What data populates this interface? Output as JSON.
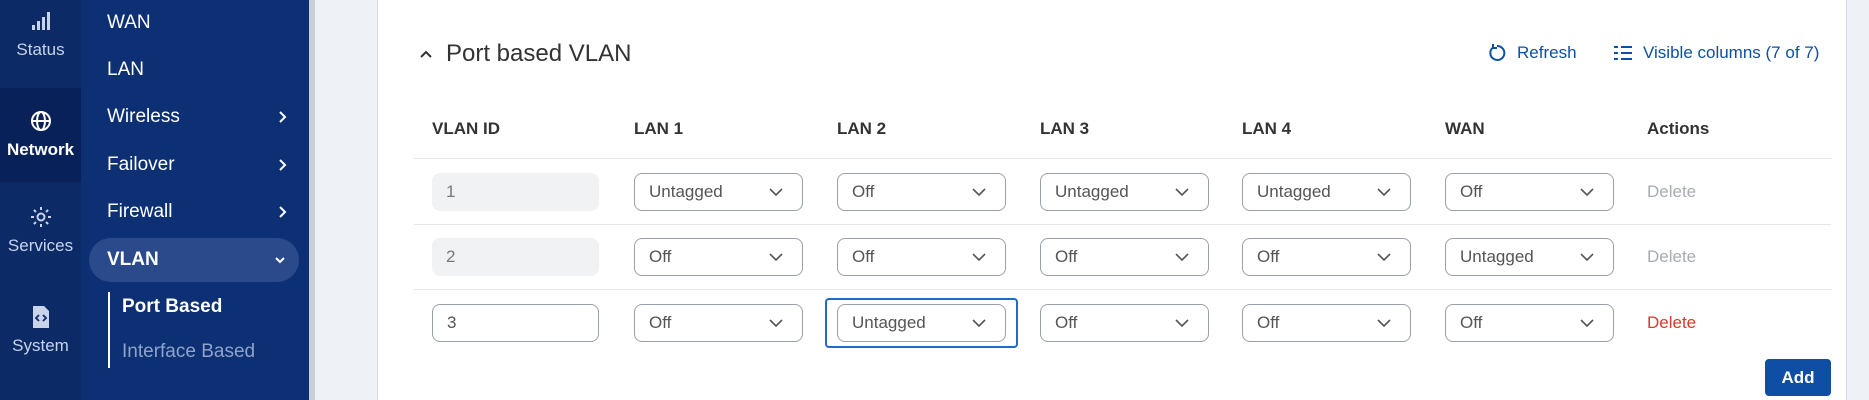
{
  "rail": [
    {
      "label": "Status",
      "icon": "signal-icon"
    },
    {
      "label": "Network",
      "icon": "globe-icon",
      "active": true
    },
    {
      "label": "Services",
      "icon": "gear-icon"
    },
    {
      "label": "System",
      "icon": "file-code-icon"
    }
  ],
  "nav": {
    "items": [
      {
        "label": "WAN"
      },
      {
        "label": "LAN"
      },
      {
        "label": "Wireless"
      },
      {
        "label": "Failover"
      },
      {
        "label": "Firewall"
      },
      {
        "label": "VLAN"
      }
    ],
    "sub_items": [
      {
        "label": "Port Based"
      },
      {
        "label": "Interface Based"
      }
    ]
  },
  "section": {
    "title": "Port based VLAN",
    "refresh_label": "Refresh",
    "columns_label": "Visible columns (7 of 7)"
  },
  "table": {
    "headers": [
      "VLAN ID",
      "LAN 1",
      "LAN 2",
      "LAN 3",
      "LAN 4",
      "WAN",
      "Actions"
    ],
    "rows": [
      {
        "id": "1",
        "ports": [
          "Untagged",
          "Off",
          "Untagged",
          "Untagged",
          "Off"
        ],
        "action": "Delete"
      },
      {
        "id": "2",
        "ports": [
          "Off",
          "Off",
          "Off",
          "Off",
          "Untagged"
        ],
        "action": "Delete"
      },
      {
        "id": "3",
        "ports": [
          "Off",
          "Untagged",
          "Off",
          "Off",
          "Off"
        ],
        "action": "Delete"
      }
    ]
  },
  "add_label": "Add",
  "colors": {
    "primary": "#0e4fa5",
    "danger": "#d43a2a",
    "rail": "#0b2a66",
    "nav": "#0d2f74"
  }
}
